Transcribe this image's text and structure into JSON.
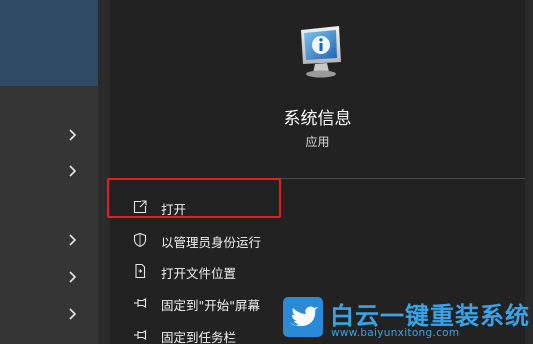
{
  "app": {
    "title": "系统信息",
    "subtitle": "应用",
    "icon": "system-information-icon"
  },
  "menu": [
    {
      "label": "打开",
      "icon": "open-icon"
    },
    {
      "label": "以管理员身份运行",
      "icon": "shield-icon"
    },
    {
      "label": "打开文件位置",
      "icon": "file-location-icon"
    },
    {
      "label": "固定到\"开始\"屏幕",
      "icon": "pin-icon"
    },
    {
      "label": "固定到任务栏",
      "icon": "pin-icon"
    }
  ],
  "sidebar": {
    "chevrons": [
      "chevron-right-icon",
      "chevron-right-icon",
      "chevron-right-icon",
      "chevron-right-icon",
      "chevron-right-icon"
    ]
  },
  "watermark": {
    "brand": "白云一键重装系统",
    "url": "www.baiyunxitong.com"
  },
  "colors": {
    "highlight": "#e02020",
    "watermark": "#3aa3e8",
    "selected_sidebar": "#2f4a63"
  }
}
